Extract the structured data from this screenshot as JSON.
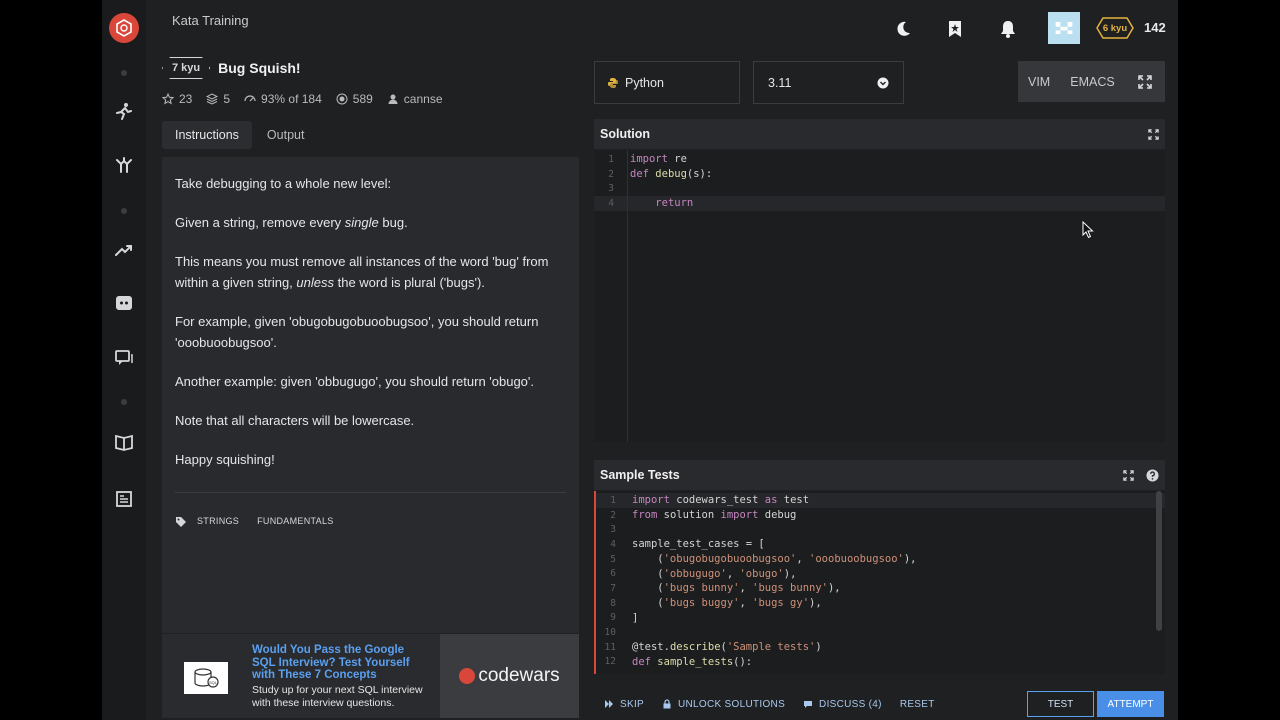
{
  "app": {
    "section_title": "Kata Training",
    "rank_badge": "6 kyu",
    "honor": "142",
    "accent": "#d9463a"
  },
  "kata": {
    "kyu": "7 kyu",
    "title": "Bug Squish!",
    "stats": {
      "stars": "23",
      "collections": "5",
      "satisfaction": "93% of 184",
      "completions": "589",
      "author": "cannse"
    },
    "tabs": [
      "Instructions",
      "Output"
    ],
    "description": [
      "Take debugging to a whole new level:",
      "Given a string, remove every single bug.",
      "This means you must remove all instances of the word 'bug' from within a given string, unless the word is plural ('bugs').",
      "For example, given 'obugobugobuoobugsoo', you should return 'ooobuoobugsoo'.",
      "Another example: given 'obbugugo', you should return 'obugo'.",
      "Note that all characters will be lowercase.",
      "Happy squishing!"
    ],
    "tags": [
      "STRINGS",
      "FUNDAMENTALS"
    ]
  },
  "ad": {
    "title": "Would You Pass the Google SQL Interview? Test Yourself with These 7 Concepts",
    "subtitle": "Study up for your next SQL interview with these interview questions.",
    "brand": "codewars",
    "image_label": "SQL"
  },
  "editor": {
    "language": "Python",
    "version": "3.11",
    "modes": [
      "VIM",
      "EMACS"
    ],
    "solution_title": "Solution",
    "sample_title": "Sample Tests"
  },
  "bottom_bar": {
    "skip": "SKIP",
    "unlock": "UNLOCK SOLUTIONS",
    "discuss": "DISCUSS (4)",
    "reset": "RESET",
    "test": "TEST",
    "attempt": "ATTEMPT"
  }
}
